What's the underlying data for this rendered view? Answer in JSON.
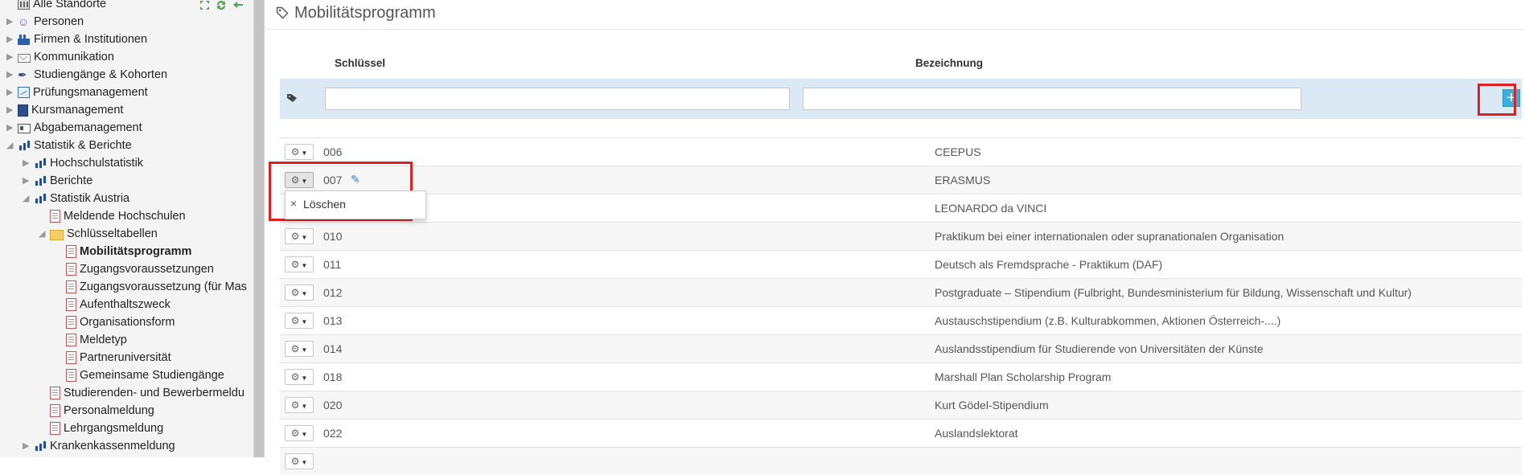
{
  "sidebar": {
    "items": [
      {
        "label": "Alle Standorte",
        "icon": "building-icon",
        "arrow": ""
      },
      {
        "label": "Personen",
        "icon": "people-icon",
        "arrow": "▶"
      },
      {
        "label": "Firmen & Institutionen",
        "icon": "factory-icon",
        "arrow": "▶"
      },
      {
        "label": "Kommunikation",
        "icon": "mail-icon",
        "arrow": "▶"
      },
      {
        "label": "Studiengänge & Kohorten",
        "icon": "feather-icon",
        "arrow": "▶"
      },
      {
        "label": "Prüfungsmanagement",
        "icon": "chart-icon",
        "arrow": "▶"
      },
      {
        "label": "Kursmanagement",
        "icon": "book-icon",
        "arrow": "▶"
      },
      {
        "label": "Abgabemanagement",
        "icon": "card-icon",
        "arrow": "▶"
      },
      {
        "label": "Statistik & Berichte",
        "icon": "bar-chart-icon",
        "arrow": "◢"
      },
      {
        "label": "Hochschulstatistik",
        "icon": "bar-chart-icon",
        "arrow": "▶"
      },
      {
        "label": "Berichte",
        "icon": "bar-chart-icon",
        "arrow": "▶"
      },
      {
        "label": "Statistik Austria",
        "icon": "bar-chart-icon",
        "arrow": "◢"
      },
      {
        "label": "Meldende Hochschulen",
        "icon": "document-icon",
        "arrow": ""
      },
      {
        "label": "Schlüsseltabellen",
        "icon": "folder-open-icon",
        "arrow": "◢"
      },
      {
        "label": "Mobilitätsprogramm",
        "icon": "document-icon",
        "arrow": "",
        "active": true
      },
      {
        "label": "Zugangsvoraussetzungen",
        "icon": "document-icon",
        "arrow": ""
      },
      {
        "label": "Zugangsvoraussetzung (für Mas",
        "icon": "document-icon",
        "arrow": ""
      },
      {
        "label": "Aufenthaltszweck",
        "icon": "document-icon",
        "arrow": ""
      },
      {
        "label": "Organisationsform",
        "icon": "document-icon",
        "arrow": ""
      },
      {
        "label": "Meldetyp",
        "icon": "document-icon",
        "arrow": ""
      },
      {
        "label": "Partneruniversität",
        "icon": "document-icon",
        "arrow": ""
      },
      {
        "label": "Gemeinsame Studiengänge",
        "icon": "document-icon",
        "arrow": ""
      },
      {
        "label": "Studierenden- und Bewerbermeldu",
        "icon": "document-icon",
        "arrow": ""
      },
      {
        "label": "Personalmeldung",
        "icon": "document-icon",
        "arrow": ""
      },
      {
        "label": "Lehrgangsmeldung",
        "icon": "document-icon",
        "arrow": ""
      },
      {
        "label": "Krankenkassenmeldung",
        "icon": "bar-chart-icon",
        "arrow": "▶"
      }
    ]
  },
  "page": {
    "title": "Mobilitätsprogramm",
    "icon": "tag-icon"
  },
  "table": {
    "columns": {
      "key": "Schlüssel",
      "description": "Bezeichnung"
    },
    "new_row": {
      "key_value": "",
      "description_value": "",
      "add_label": "+"
    },
    "rows": [
      {
        "key": "006",
        "description": "CEEPUS"
      },
      {
        "key": "007",
        "description": "ERASMUS"
      },
      {
        "key": "",
        "description": "LEONARDO da VINCI"
      },
      {
        "key": "010",
        "description": "Praktikum bei einer internationalen oder supranationalen Organisation"
      },
      {
        "key": "011",
        "description": "Deutsch als Fremdsprache - Praktikum (DAF)"
      },
      {
        "key": "012",
        "description": "Postgraduate – Stipendium (Fulbright, Bundesministerium für Bildung, Wissenschaft und Kultur)"
      },
      {
        "key": "013",
        "description": "Austauschstipendium (z.B. Kulturabkommen, Aktionen Österreich-....)"
      },
      {
        "key": "014",
        "description": "Auslandsstipendium für Studierende von Universitäten der Künste"
      },
      {
        "key": "018",
        "description": "Marshall Plan Scholarship Program"
      },
      {
        "key": "020",
        "description": "Kurt Gödel-Stipendium"
      },
      {
        "key": "022",
        "description": "Auslandslektorat"
      },
      {
        "key": "",
        "description": ""
      }
    ]
  },
  "dropdown": {
    "delete_label": "Löschen",
    "delete_glyph": "×"
  },
  "colors": {
    "accent": "#3aaee0",
    "highlight": "#e02020",
    "new_row_bg": "#dbe9f5"
  }
}
